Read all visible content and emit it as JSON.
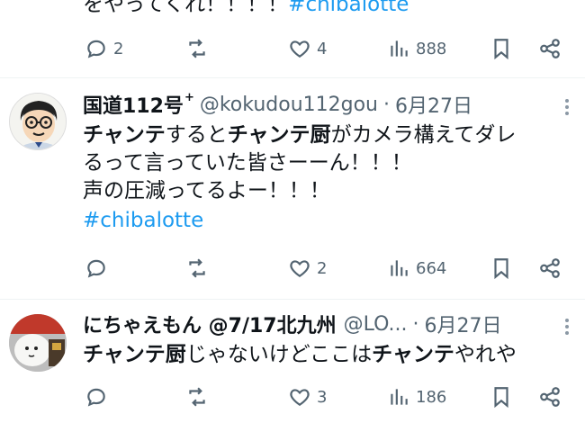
{
  "top_tweet": {
    "text_plain": "をやってくれ！！！！",
    "hashtag": "#chibalotte",
    "reply_count": "2",
    "retweet_count": "",
    "like_count": "4",
    "view_count": "888"
  },
  "tweet1": {
    "name": "国道112号",
    "name_sup": "+",
    "handle": "@kokudou112gou",
    "dot": "·",
    "date": "6月27日",
    "line1_b1": "チャンテ",
    "line1_t1": "すると",
    "line1_b2": "チャンテ厨",
    "line1_t2": "がカメラ構えてダレ",
    "line2": "るって言っていた皆さーーん！！！",
    "line3": "声の圧減ってるよー！！！",
    "hashtag": "#chibalotte",
    "reply_count": "",
    "retweet_count": "",
    "like_count": "2",
    "view_count": "664"
  },
  "tweet2": {
    "name": "にちゃえもん @7/17北九州",
    "handle": "@LO...",
    "dot": "·",
    "date": "6月27日",
    "line1_b1": "チャンテ厨",
    "line1_t1": "じゃないけどここは",
    "line1_b2": "チャンテ",
    "line1_t2": "やれや",
    "reply_count": "",
    "retweet_count": "",
    "like_count": "3",
    "view_count": "186"
  },
  "icons": [
    "reply-icon",
    "retweet-icon",
    "like-icon",
    "views-icon",
    "bookmark-icon",
    "share-icon",
    "more-icon"
  ],
  "colors": {
    "hashtag": "#1d9bf0",
    "secondary": "#536471",
    "text": "#0f1419",
    "divider": "#eff3f4"
  }
}
